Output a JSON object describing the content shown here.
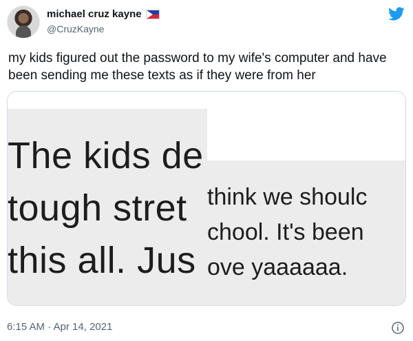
{
  "tweet": {
    "display_name": "michael cruz kayne",
    "handle": "@CruzKayne",
    "text": "my kids figured out the password to my wife's computer and have been sending me these texts as if they were from her",
    "timestamp": "6:15 AM · Apr 14, 2021"
  },
  "media": {
    "left_lines": [
      "The kids de",
      "tough stret",
      "this all. Jus"
    ],
    "right_lines": [
      "think we shoulc",
      "chool. It's been",
      "ove yaaaaaa."
    ]
  },
  "icons": {
    "twitter": "twitter-bird-icon",
    "flag": "philippines-flag-icon",
    "info": "info-icon"
  },
  "colors": {
    "twitter_blue": "#1d9bf0",
    "text": "#0f1419",
    "secondary": "#536471"
  }
}
